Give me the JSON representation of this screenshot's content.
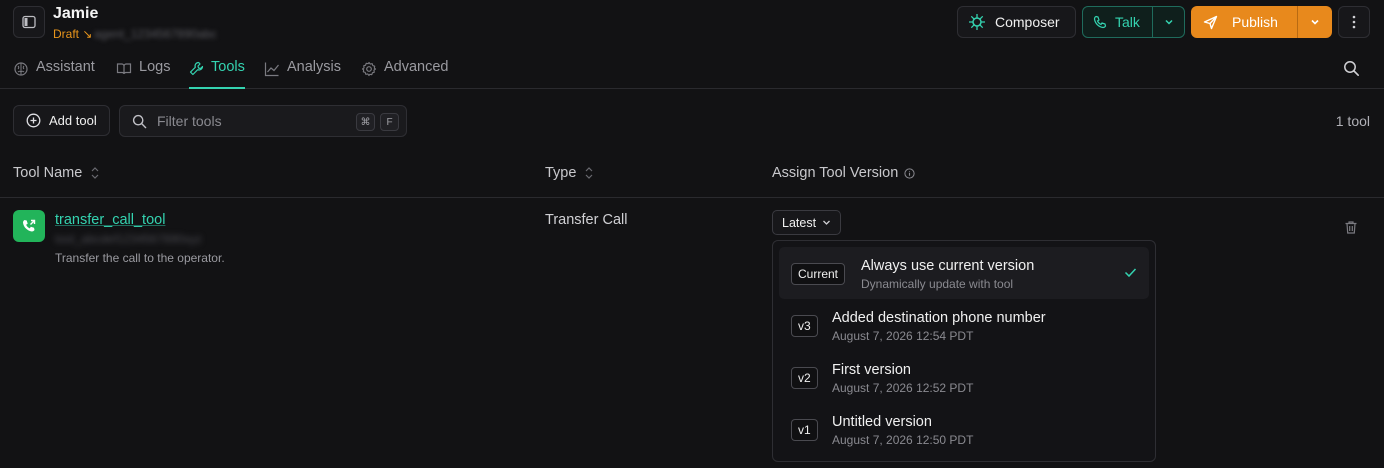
{
  "header": {
    "agent_name": "Jamie",
    "status": "Draft",
    "agent_id_masked": "agent_1234567890abc",
    "composer_label": "Composer",
    "talk_label": "Talk",
    "publish_label": "Publish"
  },
  "tabs": [
    {
      "label": "Assistant",
      "icon": "brain-icon"
    },
    {
      "label": "Logs",
      "icon": "book-icon"
    },
    {
      "label": "Tools",
      "icon": "wrench-icon",
      "active": true
    },
    {
      "label": "Analysis",
      "icon": "chart-icon"
    },
    {
      "label": "Advanced",
      "icon": "gear-icon"
    }
  ],
  "toolbar": {
    "add_tool_label": "Add tool",
    "filter_placeholder": "Filter tools",
    "shortcut_keys": [
      "⌘",
      "F"
    ],
    "tool_count": "1 tool"
  },
  "table": {
    "columns": [
      "Tool Name",
      "Type",
      "Assign Tool Version"
    ],
    "rows": [
      {
        "name": "transfer_call_tool",
        "id_masked": "tool_abcdef1234567890xyz",
        "description": "Transfer the call to the operator.",
        "type": "Transfer Call",
        "version": "Latest"
      }
    ]
  },
  "version_dropdown": {
    "options": [
      {
        "badge": "Current",
        "label": "Always use current version",
        "sub": "Dynamically update with tool",
        "selected": true
      },
      {
        "badge": "v3",
        "label": "Added destination phone number",
        "sub": "August 7, 2026 12:54 PDT"
      },
      {
        "badge": "v2",
        "label": "First version",
        "sub": "August 7, 2026 12:52 PDT"
      },
      {
        "badge": "v1",
        "label": "Untitled version",
        "sub": "August 7, 2026 12:50 PDT"
      }
    ]
  },
  "colors": {
    "accent": "#34d3b0",
    "publish": "#e8891c",
    "draft": "#e8951c",
    "background": "#121214"
  }
}
